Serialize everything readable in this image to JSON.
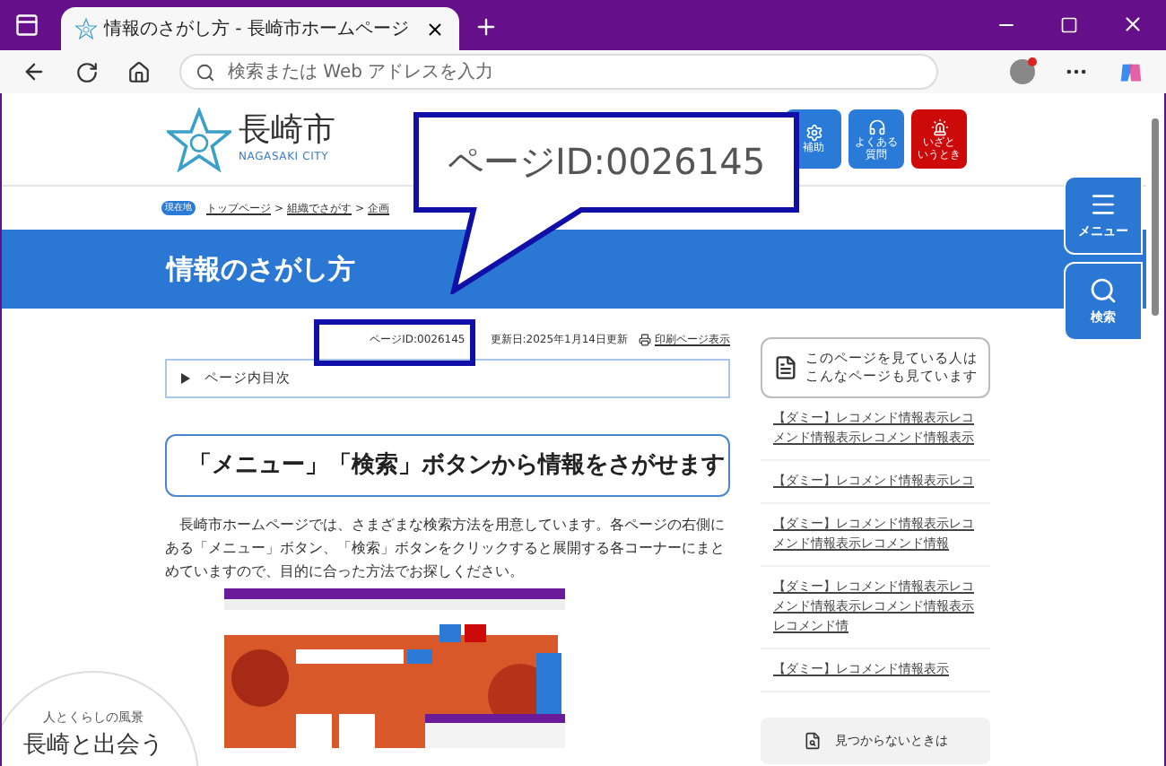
{
  "browser": {
    "tab": {
      "title": "情報のさがし方 - 長崎市ホームページ",
      "selected": true
    },
    "address_placeholder": "検索または Web アドレスを入力"
  },
  "header": {
    "logo_name": "長崎市",
    "logo_sub": "NAGASAKI CITY",
    "buttons": [
      {
        "kind": "gear",
        "lines": [
          "補助"
        ],
        "color": "#2a7bd8"
      },
      {
        "kind": "headset",
        "lines": [
          "よくある",
          "質問"
        ],
        "color": "#2a7bd8"
      },
      {
        "kind": "alarm",
        "lines": [
          "いざと",
          "いうとき"
        ],
        "color": "#cc0a0a"
      }
    ]
  },
  "breadcrumb": {
    "badge": "現在地",
    "items": [
      "トップページ",
      "組織でさがす",
      "企画"
    ],
    "separators": [
      ">",
      ">"
    ]
  },
  "page_title": "情報のさがし方",
  "meta": {
    "page_id": "ページID:0026145",
    "updated": "更新日:2025年1月14日更新",
    "print": "印刷ページ表示"
  },
  "toc": {
    "label": "ページ内目次",
    "expanded": false
  },
  "heading": "「メニュー」「検索」ボタンから情報をさがせます",
  "paragraph": "長崎市ホームページでは、さまざまな検索方法を用意しています。各ページの右側にある「メニュー」ボタン、「検索」ボタンをクリックすると展開する各コーナーにまとめていますので、目的に合った方法でお探しください。",
  "sidebar": {
    "recommend_lines": [
      "このページを見ている人は",
      "こんなページも見ています"
    ],
    "links": [
      "【ダミー】レコメンド情報表示レコメンド情報表示レコメンド情報表示",
      "【ダミー】レコメンド情報表示レコ",
      "【ダミー】レコメンド情報表示レコメンド情報表示レコメンド情報",
      "【ダミー】レコメンド情報表示レコメンド情報表示レコメンド情報表示レコメンド情",
      "【ダミー】レコメンド情報表示"
    ],
    "not_found": "見つからないときは"
  },
  "side_buttons": [
    {
      "kind": "menu",
      "label": "メニュー"
    },
    {
      "kind": "search",
      "label": "検索"
    }
  ],
  "callout": {
    "text": "ページID:0026145"
  },
  "badge": {
    "lines": [
      "人とくらしの風景",
      "長崎と出会う"
    ]
  }
}
